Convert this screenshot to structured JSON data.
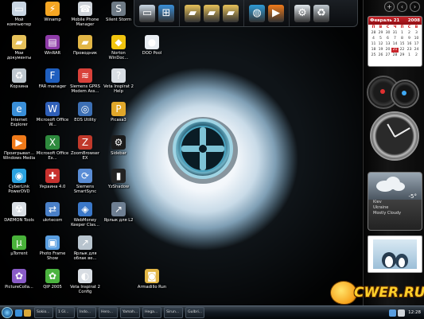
{
  "desktop_icons": [
    {
      "label": "Мой компьютер",
      "icon": "computer-icon",
      "color": "#c9d6e3"
    },
    {
      "label": "Мои документы",
      "icon": "folder-icon",
      "color": "#e6c15a"
    },
    {
      "label": "Корзина",
      "icon": "recycle-bin-icon",
      "color": "#bfc8cf"
    },
    {
      "label": "Internet Explorer",
      "icon": "ie-icon",
      "color": "#3a8fd8"
    },
    {
      "label": "Проигрыват... Windows Media",
      "icon": "media-player-icon",
      "color": "#f07a1a"
    },
    {
      "label": "CyberLink PowerDVD",
      "icon": "dvd-icon",
      "color": "#2aa2e0"
    },
    {
      "label": "DAEMON Tools",
      "icon": "daemon-icon",
      "color": "#d8dde3"
    },
    {
      "label": "µTorrent",
      "icon": "utorrent-icon",
      "color": "#49b23a"
    },
    {
      "label": "PictureColla...",
      "icon": "picture-icon",
      "color": "#8a5cc8"
    },
    {
      "label": "Winamp",
      "icon": "winamp-icon",
      "color": "#f5a623"
    },
    {
      "label": "WinRAR",
      "icon": "winrar-icon",
      "color": "#8e3ba8"
    },
    {
      "label": "FAR manager",
      "icon": "far-icon",
      "color": "#1f5fbf"
    },
    {
      "label": "Microsoft Office W...",
      "icon": "word-icon",
      "color": "#2f5fb8"
    },
    {
      "label": "Microsoft Office Ex...",
      "icon": "excel-icon",
      "color": "#2e8b3e"
    },
    {
      "label": "Украина 4.0",
      "icon": "map-icon",
      "color": "#c8312e"
    },
    {
      "label": "ukrtecom",
      "icon": "network-icon",
      "color": "#4a80c8"
    },
    {
      "label": "Photo Frame Show",
      "icon": "photo-icon",
      "color": "#5a9ee0"
    },
    {
      "label": "QIP 2005",
      "icon": "qip-icon",
      "color": "#4bb33f"
    },
    {
      "label": "Mobile Phone Manager",
      "icon": "phone-icon",
      "color": "#cfd4da"
    },
    {
      "label": "Проводник",
      "icon": "explorer-icon",
      "color": "#e2b646"
    },
    {
      "label": "Siemens GPRS Modem Ass...",
      "icon": "modem-icon",
      "color": "#d9413a"
    },
    {
      "label": "EOS Utility",
      "icon": "camera-icon",
      "color": "#3c6fb4"
    },
    {
      "label": "ZoomBrowser EX",
      "icon": "zoombrowser-icon",
      "color": "#c0392b"
    },
    {
      "label": "Siemens SmartSync",
      "icon": "sync-icon",
      "color": "#5a8dd6"
    },
    {
      "label": "WebMoney Keeper Clas...",
      "icon": "webmoney-icon",
      "color": "#3b78c9"
    },
    {
      "label": "Ярлык для облак ве...",
      "icon": "shortcut-icon",
      "color": "#b8c4ce"
    },
    {
      "label": "Veta Inspirat 2 Config",
      "icon": "veta-icon",
      "color": "#d8dde3"
    },
    {
      "label": "Silent Storm",
      "icon": "game-icon",
      "color": "#6f7b86"
    },
    {
      "label": "Norton WinDoc...",
      "icon": "norton-icon",
      "color": "#f1c40f"
    },
    {
      "label": "Veta Inspirat 2 Help",
      "icon": "help-icon",
      "color": "#d8dde3"
    },
    {
      "label": "Picasa3",
      "icon": "picasa-icon",
      "color": "#e0a72a"
    },
    {
      "label": "Sidebar",
      "icon": "sidebar-icon",
      "color": "#1b1b1b"
    },
    {
      "label": "YzShadow",
      "icon": "yzshadow-icon",
      "color": "#222"
    },
    {
      "label": "Ярлык для L2",
      "icon": "shortcut-icon",
      "color": "#6e7f92"
    },
    {
      "label": "DOD Pool",
      "icon": "pool-icon",
      "color": "#e8edf2"
    },
    {
      "label": "Armadillo Run",
      "icon": "armadillo-icon",
      "color": "#e2b646"
    },
    {
      "label": "Instant DVD Recorder",
      "icon": "dvd-recorder-icon",
      "color": "#e8c03a"
    },
    {
      "label": "DepositUplo...",
      "icon": "deposit-icon",
      "color": "#c8312e"
    }
  ],
  "toolbar": {
    "groups": [
      [
        {
          "icon": "computer-icon",
          "color": "#c9d6e3"
        },
        {
          "icon": "windows-icon",
          "color": "#3a8fd8"
        }
      ],
      [
        {
          "icon": "folder-icon",
          "color": "#e6c15a"
        },
        {
          "icon": "documents-icon",
          "color": "#e6c15a"
        },
        {
          "icon": "pictures-icon",
          "color": "#e6c15a"
        }
      ],
      [
        {
          "icon": "globe-icon",
          "color": "#2e9bd6"
        },
        {
          "icon": "media-player-icon",
          "color": "#f07a1a"
        }
      ],
      [
        {
          "icon": "gear-icon",
          "color": "#dfe6ec"
        },
        {
          "icon": "recycle-bin-icon",
          "color": "#bfc8cf"
        }
      ]
    ]
  },
  "sidebar": {
    "calendar": {
      "month_year": "Февраль 21",
      "year": "2008",
      "weekdays": [
        "П",
        "В",
        "С",
        "Ч",
        "П",
        "С",
        "В"
      ],
      "days": [
        "28",
        "29",
        "30",
        "31",
        "1",
        "2",
        "3",
        "4",
        "5",
        "6",
        "7",
        "8",
        "9",
        "10",
        "11",
        "12",
        "13",
        "14",
        "15",
        "16",
        "17",
        "18",
        "19",
        "20",
        "21",
        "22",
        "23",
        "24",
        "25",
        "26",
        "27",
        "28",
        "29",
        "1",
        "2"
      ],
      "today": "21"
    },
    "weather": {
      "temp": "-5°",
      "city": "Kiev",
      "country": "Ukraine",
      "condition": "Mostly Cloudy"
    }
  },
  "taskbar": {
    "tasks": [
      "Sokio...",
      "1 Gl...",
      "Indo...",
      "Hero...",
      "Yamah...",
      "Hega...",
      "Sirun...",
      "Gulbri..."
    ],
    "clock": "12:28"
  },
  "watermark": "CWER.RU",
  "colors": {
    "accent": "#c8242a",
    "taskbar": "#111820"
  }
}
